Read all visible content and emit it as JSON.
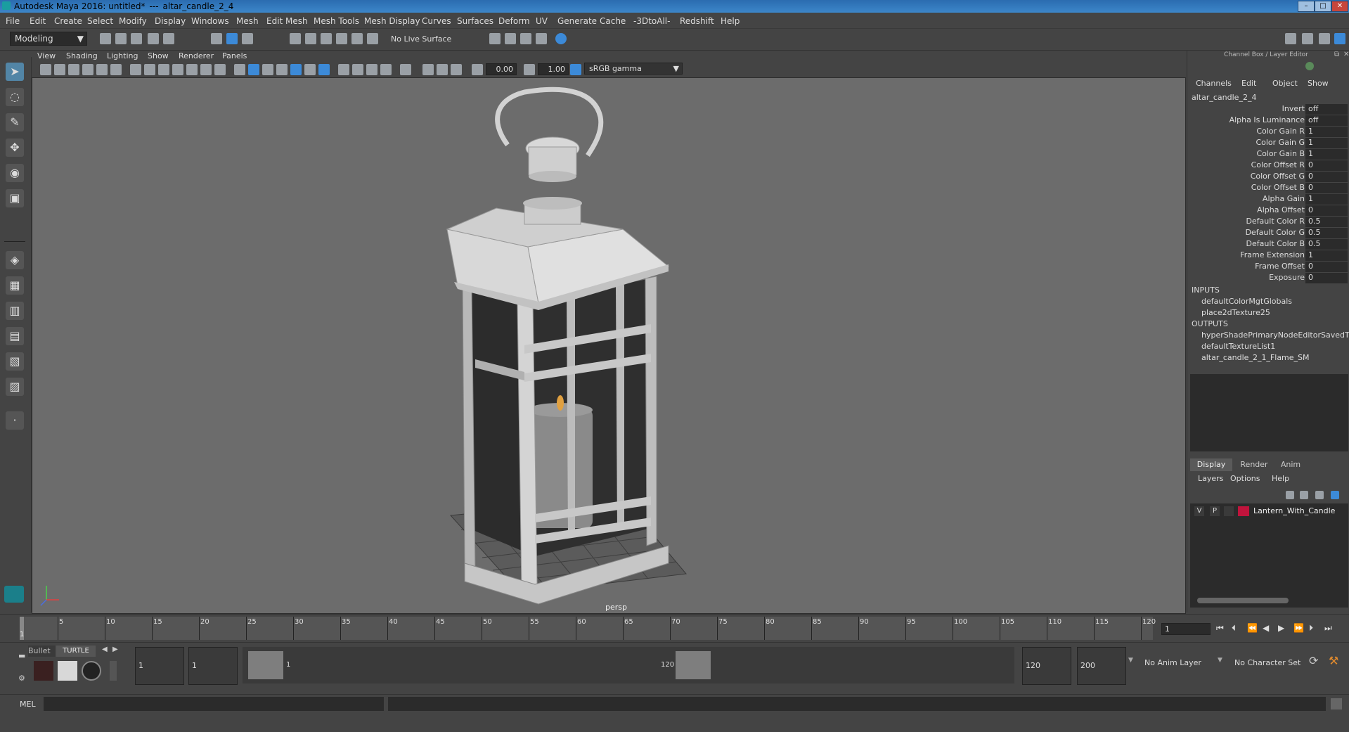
{
  "window": {
    "app_title": "Autodesk Maya 2016: untitled*",
    "separator": "---",
    "object_name": "altar_candle_2_4"
  },
  "menubar": {
    "items": [
      "File",
      "Edit",
      "Create",
      "Select",
      "Modify",
      "Display",
      "Windows",
      "Mesh",
      "Edit Mesh",
      "Mesh Tools",
      "Mesh Display",
      "Curves",
      "Surfaces",
      "Deform",
      "UV",
      "Generate",
      "Cache",
      "-3DtoAll-",
      "Redshift",
      "Help"
    ]
  },
  "shelf": {
    "mode_dropdown": "Modeling",
    "live_surface": "No Live Surface"
  },
  "viewport": {
    "menu": [
      "View",
      "Shading",
      "Lighting",
      "Show",
      "Renderer",
      "Panels"
    ],
    "exposure_value": "0.00",
    "gamma_value": "1.00",
    "color_space": "sRGB gamma",
    "camera_label": "persp"
  },
  "channel_box": {
    "header": "Channel Box / Layer Editor",
    "menu": [
      "Channels",
      "Edit",
      "Object",
      "Show"
    ],
    "node_name": "altar_candle_2_4",
    "attributes": [
      {
        "label": "Invert",
        "value": "off"
      },
      {
        "label": "Alpha Is Luminance",
        "value": "off"
      },
      {
        "label": "Color Gain R",
        "value": "1"
      },
      {
        "label": "Color Gain G",
        "value": "1"
      },
      {
        "label": "Color Gain B",
        "value": "1"
      },
      {
        "label": "Color Offset R",
        "value": "0"
      },
      {
        "label": "Color Offset G",
        "value": "0"
      },
      {
        "label": "Color Offset B",
        "value": "0"
      },
      {
        "label": "Alpha Gain",
        "value": "1"
      },
      {
        "label": "Alpha Offset",
        "value": "0"
      },
      {
        "label": "Default Color R",
        "value": "0.5"
      },
      {
        "label": "Default Color G",
        "value": "0.5"
      },
      {
        "label": "Default Color B",
        "value": "0.5"
      },
      {
        "label": "Frame Extension",
        "value": "1"
      },
      {
        "label": "Frame Offset",
        "value": "0"
      },
      {
        "label": "Exposure",
        "value": "0"
      }
    ],
    "inputs_label": "INPUTS",
    "inputs": [
      "defaultColorMgtGlobals",
      "place2dTexture25"
    ],
    "outputs_label": "OUTPUTS",
    "outputs": [
      "hyperShadePrimaryNodeEditorSavedT...",
      "defaultTextureList1",
      "altar_candle_2_1_Flame_SM"
    ]
  },
  "layer_editor": {
    "tabs": [
      "Display",
      "Render",
      "Anim"
    ],
    "menu": [
      "Layers",
      "Options",
      "Help"
    ],
    "layer": {
      "v": "V",
      "p": "P",
      "name": "Lantern_With_Candle",
      "color": "#c0143c"
    }
  },
  "timeline": {
    "ticks": [
      "5",
      "10",
      "15",
      "20",
      "25",
      "30",
      "35",
      "40",
      "45",
      "50",
      "55",
      "60",
      "65",
      "70",
      "75",
      "80",
      "85",
      "90",
      "95",
      "100",
      "105",
      "110",
      "115",
      "120"
    ],
    "start_label": "1",
    "current_frame": "1"
  },
  "range": {
    "shelf_tabs": [
      "Bullet",
      "TURTLE"
    ],
    "start_time": "1",
    "playback_start": "1",
    "range_start_label": "1",
    "range_end_label": "120",
    "playback_end": "120",
    "end_time": "200",
    "anim_layer": "No Anim Layer",
    "character_set": "No Character Set"
  },
  "cmd": {
    "label": "MEL"
  }
}
